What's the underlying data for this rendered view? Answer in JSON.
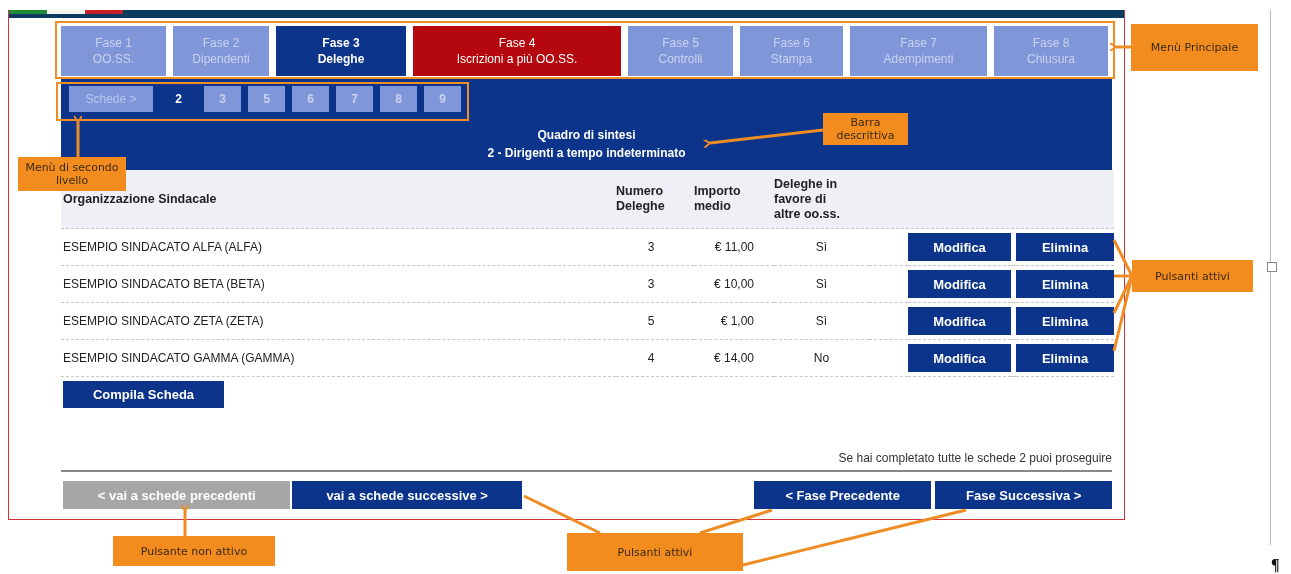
{
  "phase_menu": [
    {
      "title": "Fase 1",
      "subtitle": "OO.SS.",
      "selected": false,
      "kind": "normal"
    },
    {
      "title": "Fase 2",
      "subtitle": "Dipendenti",
      "selected": false,
      "kind": "normal"
    },
    {
      "title": "Fase 3",
      "subtitle": "Deleghe",
      "selected": true,
      "kind": "normal"
    },
    {
      "title": "Fase 4",
      "subtitle": "Iscrizioni a più OO.SS.",
      "selected": false,
      "kind": "warning"
    },
    {
      "title": "Fase 5",
      "subtitle": "Controlli",
      "selected": false,
      "kind": "normal"
    },
    {
      "title": "Fase 6",
      "subtitle": "Stampa",
      "selected": false,
      "kind": "normal"
    },
    {
      "title": "Fase 7",
      "subtitle": "Adempimenti",
      "selected": false,
      "kind": "normal"
    },
    {
      "title": "Fase 8",
      "subtitle": "Chiusura",
      "selected": false,
      "kind": "normal"
    }
  ],
  "sub_menu": {
    "label": "Schede >",
    "items": [
      {
        "label": "2",
        "selected": true
      },
      {
        "label": "3",
        "selected": false
      },
      {
        "label": "5",
        "selected": false
      },
      {
        "label": "6",
        "selected": false
      },
      {
        "label": "7",
        "selected": false
      },
      {
        "label": "8",
        "selected": false
      },
      {
        "label": "9",
        "selected": false
      }
    ]
  },
  "description_bar": [
    "Quadro di sintesi",
    "2 - Dirigenti a tempo indeterminato"
  ],
  "table": {
    "columns": [
      "Organizzazione Sindacale",
      "Numero Deleghe",
      "Importo medio",
      "Deleghe in favore di altre oo.ss."
    ],
    "rows": [
      {
        "cells": [
          "ESEMPIO SINDACATO ALFA (ALFA)",
          "3",
          "€ 11,00",
          "Sì"
        ],
        "actions": [
          "Modifica",
          "Elimina"
        ]
      },
      {
        "cells": [
          "ESEMPIO SINDACATO BETA (BETA)",
          "3",
          "€ 10,00",
          "Sì"
        ],
        "actions": [
          "Modifica",
          "Elimina"
        ]
      },
      {
        "cells": [
          "ESEMPIO SINDACATO ZETA (ZETA)",
          "5",
          "€ 1,00",
          "Sì"
        ],
        "actions": [
          "Modifica",
          "Elimina"
        ]
      },
      {
        "cells": [
          "ESEMPIO SINDACATO GAMMA (GAMMA)",
          "4",
          "€ 14,00",
          "No"
        ],
        "actions": [
          "Modifica",
          "Elimina"
        ]
      }
    ]
  },
  "compile_button": "Compila Scheda",
  "note": "Se hai completato tutte le schede 2 puoi proseguire",
  "nav_buttons": [
    {
      "label": "< vai a schede precedenti",
      "disabled": true
    },
    {
      "label": "vai a schede successive >",
      "disabled": false
    },
    {
      "label": "< Fase Precedente",
      "disabled": false
    },
    {
      "label": "Fase Successiva >",
      "disabled": false
    }
  ],
  "annotations": [
    {
      "text": "Menù Principale"
    },
    {
      "text": "Barra descrittiva"
    },
    {
      "text": "Menù di secondo livello"
    },
    {
      "text": "Pulsanti attivi"
    },
    {
      "text": "Pulsante non attivo"
    },
    {
      "text": "Pulsanti attivi"
    }
  ],
  "paragraph_mark": "¶"
}
